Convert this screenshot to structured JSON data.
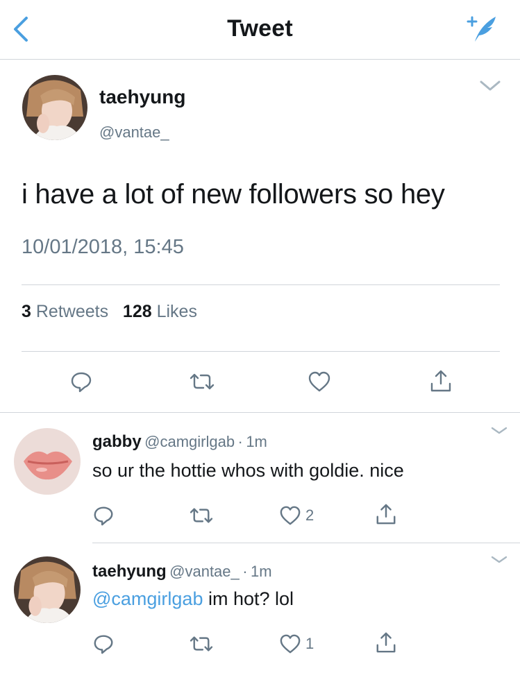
{
  "header": {
    "title": "Tweet",
    "back_icon": "chevron-left-icon",
    "compose_icon": "compose-feather-icon",
    "accent": "#1da1f2"
  },
  "main_tweet": {
    "name": "taehyung",
    "handle": "@vantae_",
    "text": "i have a lot of new followers so hey",
    "timestamp": "10/01/2018, 15:45",
    "retweets": {
      "count": "3",
      "label": "Retweets"
    },
    "likes": {
      "count": "128",
      "label": "Likes"
    }
  },
  "replies": [
    {
      "name": "gabby",
      "handle": "@camgirlgab",
      "dot": "·",
      "time": "1m",
      "mention": "",
      "text": "so ur the hottie whos with goldie. nice",
      "like_count": "2"
    },
    {
      "name": "taehyung",
      "handle": "@vantae_",
      "dot": "·",
      "time": "1m",
      "mention": "@camgirlgab",
      "text": "im hot? lol",
      "like_count": "1"
    }
  ]
}
